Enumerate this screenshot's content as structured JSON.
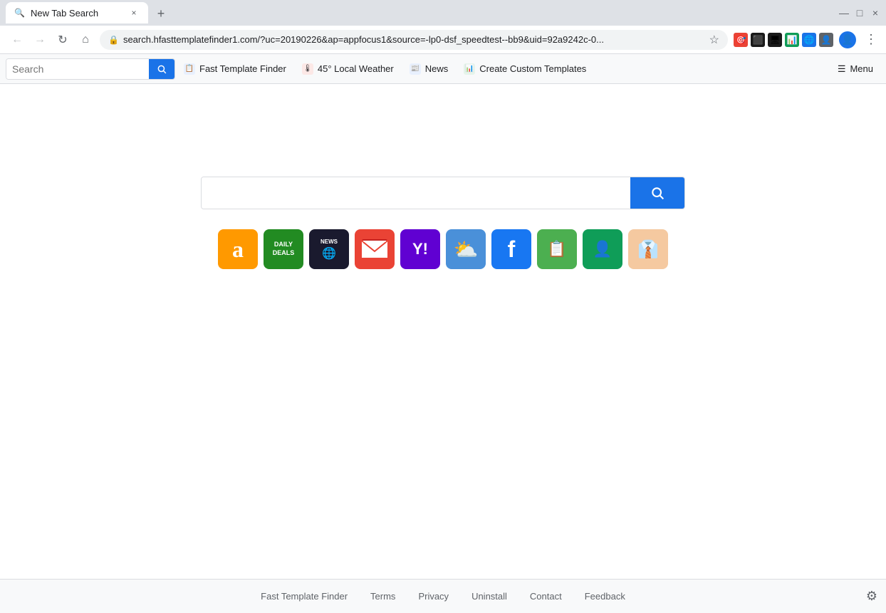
{
  "browser": {
    "tab": {
      "favicon": "🔍",
      "title": "New Tab Search",
      "close_label": "×"
    },
    "new_tab_label": "+",
    "window_controls": {
      "minimize": "—",
      "maximize": "□",
      "close": "×"
    },
    "address_bar": {
      "back": "←",
      "forward": "→",
      "refresh": "↻",
      "home": "⌂",
      "url": "search.hfasttemplatefinder1.com/?uc=20190226&ap=appfocus1&source=-lp0-dsf_speedtest--bb9&uid=92a9242c-0...",
      "star": "☆"
    }
  },
  "nav_toolbar": {
    "search_placeholder": "Search",
    "search_btn_icon": "🔍",
    "links": [
      {
        "id": "fast-template-finder",
        "icon_bg": "#e8f0fe",
        "icon_text": "📋",
        "label": "Fast Template Finder"
      },
      {
        "id": "local-weather",
        "icon_bg": "#fce8e6",
        "icon_text": "🌡",
        "label": "45° Local Weather"
      },
      {
        "id": "news",
        "icon_bg": "#e8f0fe",
        "icon_text": "📰",
        "label": "News"
      },
      {
        "id": "create-templates",
        "icon_bg": "#e6f4ea",
        "icon_text": "📊",
        "label": "Create Custom Templates"
      }
    ],
    "menu_label": "Menu",
    "menu_icon": "☰"
  },
  "main": {
    "search_placeholder": "",
    "search_btn_icon": "🔍",
    "quick_links": [
      {
        "id": "amazon",
        "bg": "#ff9900",
        "text": "a",
        "color": "#ffffff",
        "title": "Amazon"
      },
      {
        "id": "daily-deals",
        "bg": "#228b22",
        "text": "DAILY\nDEALS",
        "color": "#ffffff",
        "title": "Daily Deals"
      },
      {
        "id": "news-globe",
        "bg": "#1a1a2e",
        "text": "NEWS",
        "color": "#ffffff",
        "title": "News"
      },
      {
        "id": "gmail",
        "bg": "#ea4335",
        "text": "M",
        "color": "#ffffff",
        "title": "Gmail"
      },
      {
        "id": "yahoo",
        "bg": "#6001d2",
        "text": "Y!",
        "color": "#ffffff",
        "title": "Yahoo"
      },
      {
        "id": "weather",
        "bg": "#4a90d9",
        "text": "☁",
        "color": "#ffffff",
        "title": "Weather"
      },
      {
        "id": "facebook",
        "bg": "#1877f2",
        "text": "f",
        "color": "#ffffff",
        "title": "Facebook"
      },
      {
        "id": "forms",
        "bg": "#4caf50",
        "text": "📋",
        "color": "#ffffff",
        "title": "Forms"
      },
      {
        "id": "contacts",
        "bg": "#0f9d58",
        "text": "👤",
        "color": "#ffffff",
        "title": "Contacts"
      },
      {
        "id": "tie",
        "bg": "#f5c9a0",
        "text": "👔",
        "color": "#555555",
        "title": "Business"
      }
    ]
  },
  "footer": {
    "links": [
      {
        "id": "fast-template-finder",
        "label": "Fast Template Finder"
      },
      {
        "id": "terms",
        "label": "Terms"
      },
      {
        "id": "privacy",
        "label": "Privacy"
      },
      {
        "id": "uninstall",
        "label": "Uninstall"
      },
      {
        "id": "contact",
        "label": "Contact"
      },
      {
        "id": "feedback",
        "label": "Feedback"
      }
    ],
    "gear_icon": "⚙"
  }
}
